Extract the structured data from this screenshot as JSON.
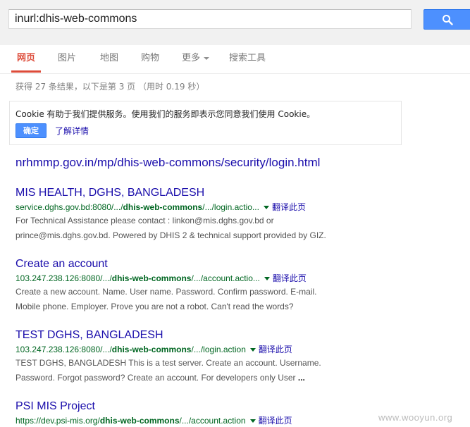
{
  "search": {
    "query": "inurl:dhis-web-commons",
    "button_icon": "search-icon"
  },
  "tabs": [
    {
      "label": "网页",
      "active": true
    },
    {
      "label": "图片"
    },
    {
      "label": "地图"
    },
    {
      "label": "购物"
    },
    {
      "label": "更多"
    },
    {
      "label": "搜索工具"
    }
  ],
  "stats": "获得 27 条结果，以下是第 3 页 （用时 0.19 秒）",
  "cookie": {
    "text": "Cookie 有助于我们提供服务。使用我们的服务即表示您同意我们使用 Cookie。",
    "ok_label": "确定",
    "more_label": "了解详情"
  },
  "results": [
    {
      "title": "nrhmmp.gov.in/mp/dhis-web-commons/security/login.html"
    },
    {
      "title": "MIS HEALTH, DGHS, BANGLADESH",
      "url_pre": "service.dghs.gov.bd:8080/.../",
      "url_bold": "dhis-web-commons",
      "url_post": "/.../login.actio...",
      "translate": "翻译此页",
      "snippet_1": "For Technical Assistance please contact : linkon@mis.dghs.gov.bd or",
      "snippet_2": "prince@mis.dghs.gov.bd. Powered by DHIS 2 & technical support provided by GIZ."
    },
    {
      "title": "Create an account",
      "url_pre": "103.247.238.126:8080/.../",
      "url_bold": "dhis-web-commons",
      "url_post": "/.../account.actio...",
      "translate": "翻译此页",
      "snippet_1": "Create a new account. Name. User name. Password. Confirm password. E-mail.",
      "snippet_2": "Mobile phone. Employer. Prove you are not a robot. Can't read the words?"
    },
    {
      "title": "TEST DGHS, BANGLADESH",
      "url_pre": "103.247.238.126:8080/.../",
      "url_bold": "dhis-web-commons",
      "url_post": "/.../login.action",
      "translate": "翻译此页",
      "snippet_1": "TEST DGHS, BANGLADESH This is a test server. Create an account. Username.",
      "snippet_2": "Password. Forgot password? Create an account. For developers only User",
      "snippet_2_tail": " ..."
    },
    {
      "title": "PSI MIS Project",
      "url_pre": "https://dev.psi-mis.org/",
      "url_bold": "dhis-web-commons",
      "url_post": "/.../account.action",
      "translate": "翻译此页"
    }
  ],
  "watermark": "www.wooyun.org",
  "colors": {
    "accent_red": "#dd4b39",
    "link_blue": "#1a0dab",
    "url_green": "#006621",
    "button_blue": "#4d90fe"
  }
}
